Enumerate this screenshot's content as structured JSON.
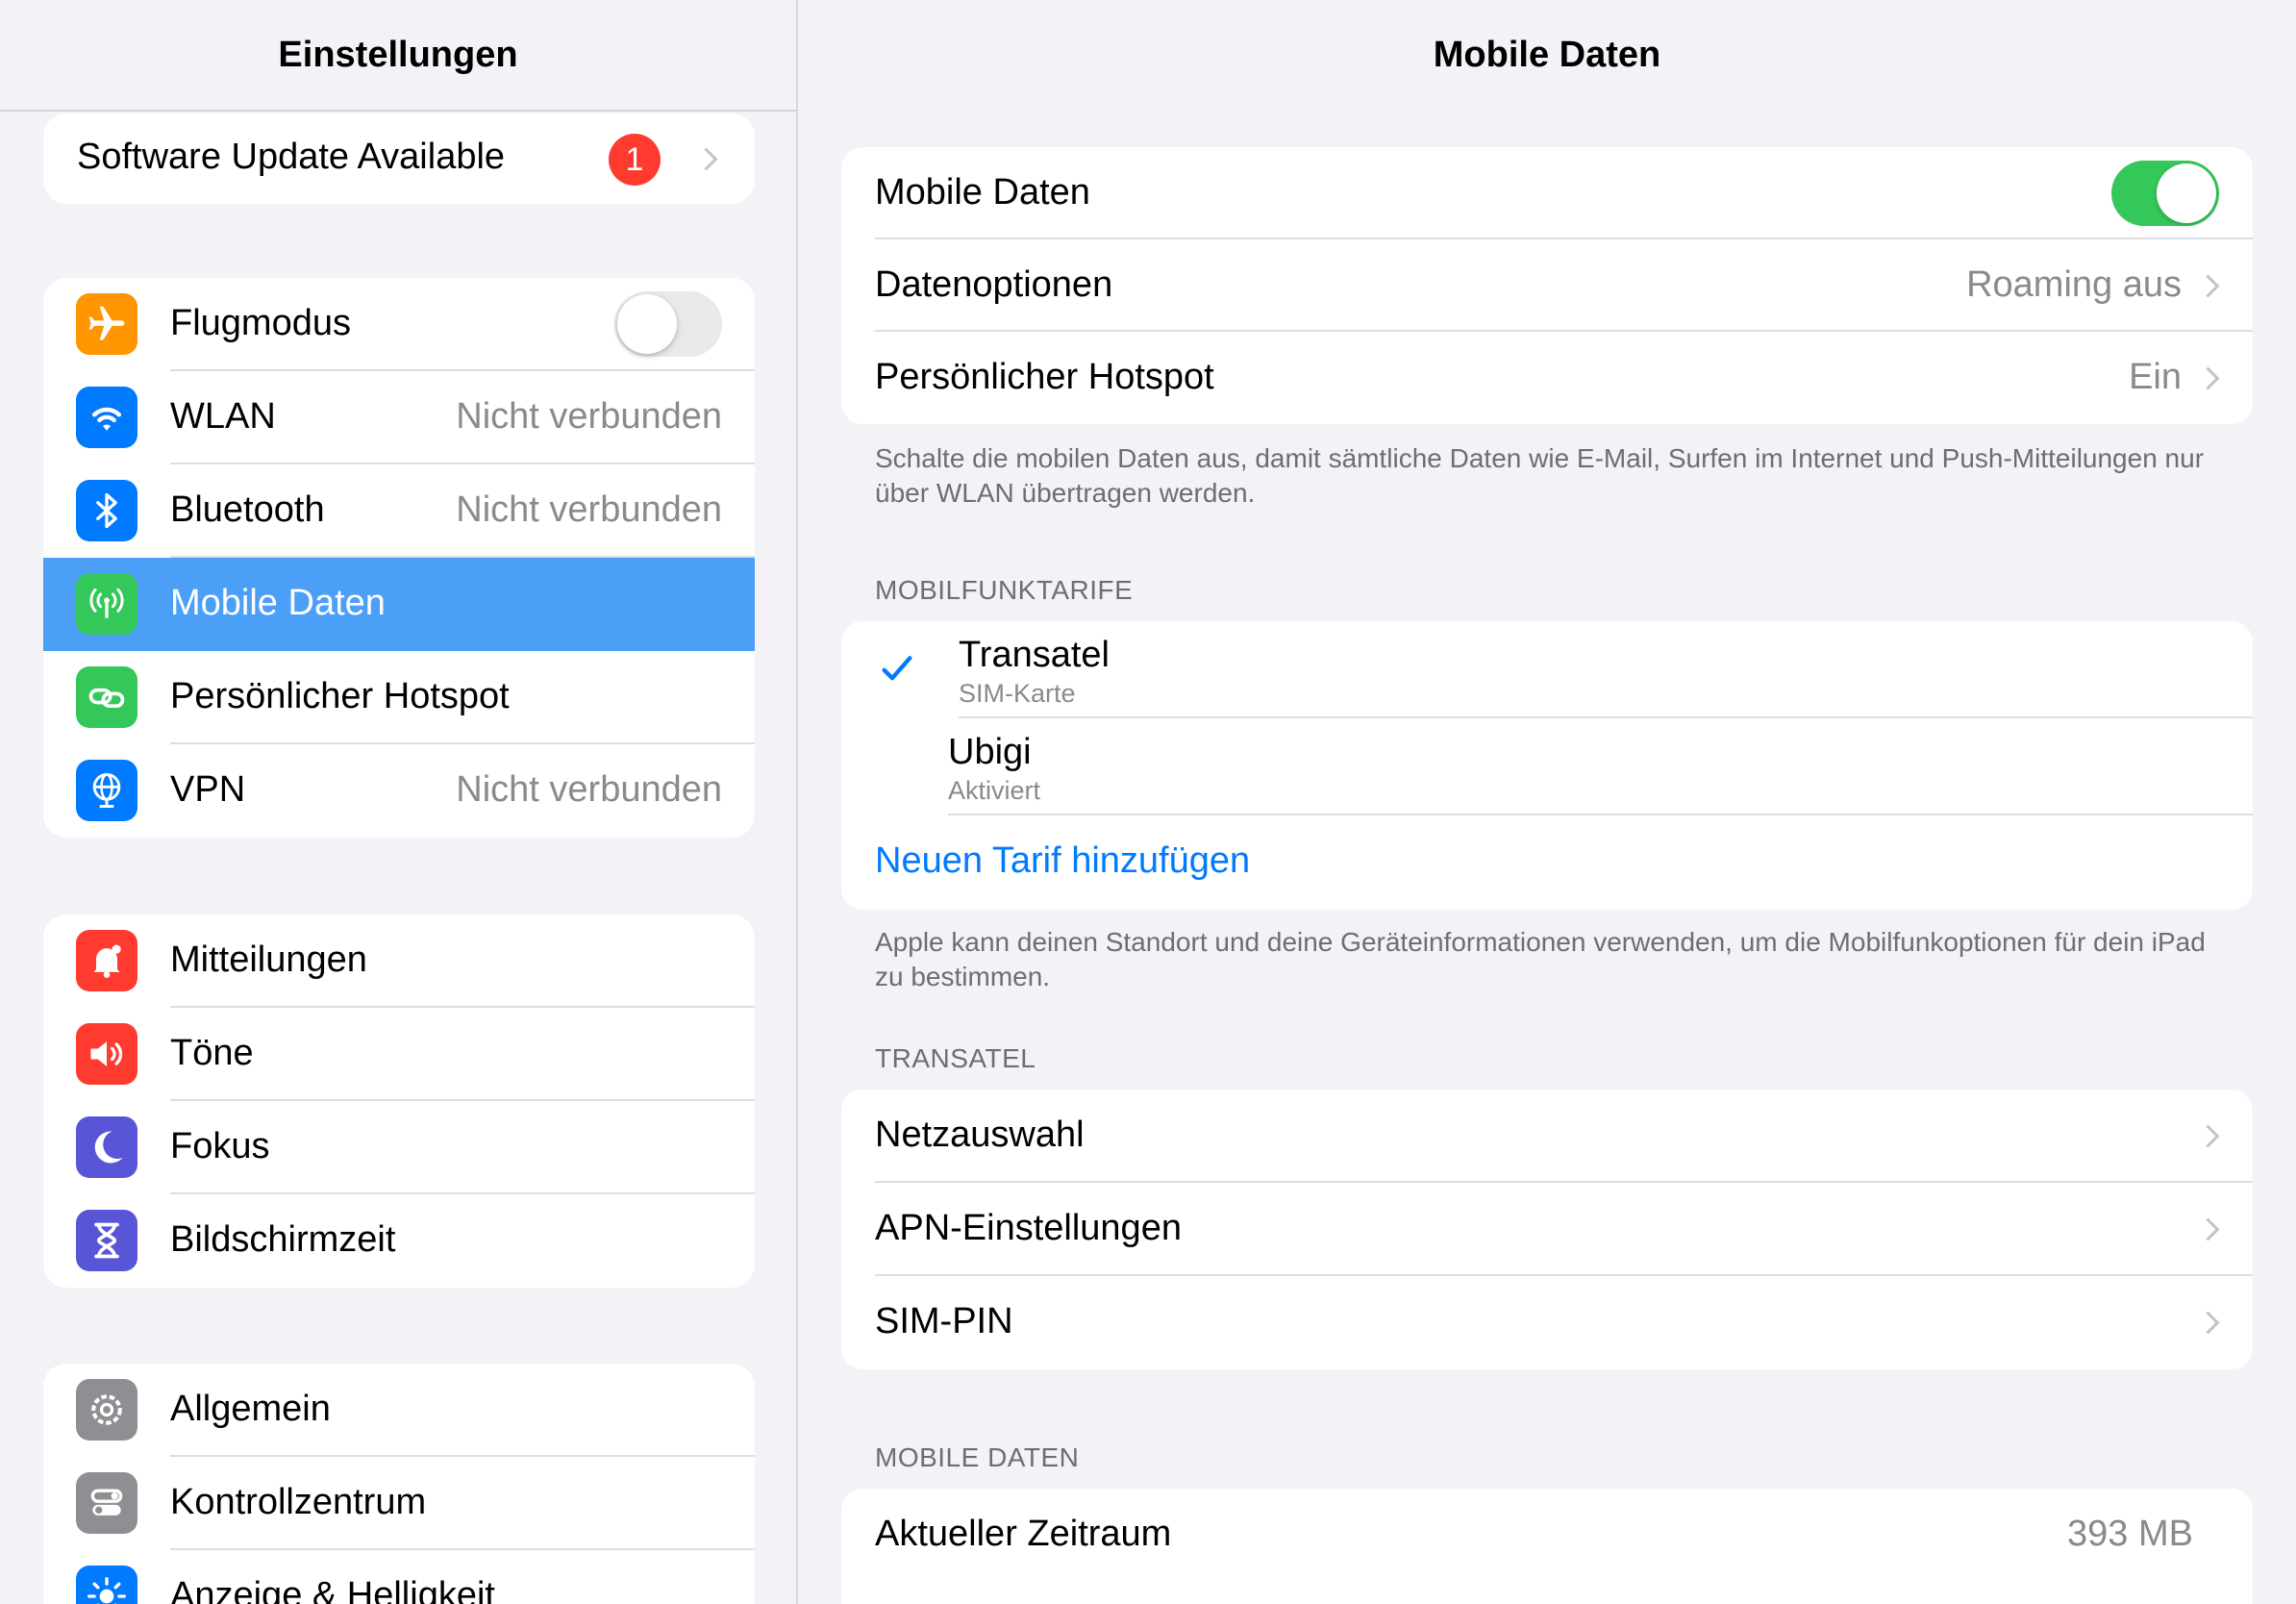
{
  "sidebar": {
    "title": "Einstellungen",
    "update": {
      "label": "Software Update Available",
      "badge": "1"
    },
    "group1": [
      {
        "label": "Flugmodus",
        "icon": "airplane-icon",
        "color": "#ff9500",
        "toggle": false
      },
      {
        "label": "WLAN",
        "value": "Nicht verbunden",
        "icon": "wifi-icon",
        "color": "#007aff"
      },
      {
        "label": "Bluetooth",
        "value": "Nicht verbunden",
        "icon": "bluetooth-icon",
        "color": "#007aff"
      },
      {
        "label": "Mobile Daten",
        "icon": "antenna-icon",
        "color": "#34c759",
        "selected": true
      },
      {
        "label": "Persönlicher Hotspot",
        "icon": "hotspot-icon",
        "color": "#34c759"
      },
      {
        "label": "VPN",
        "value": "Nicht verbunden",
        "icon": "globe-icon",
        "color": "#007aff"
      }
    ],
    "group2": [
      {
        "label": "Mitteilungen",
        "icon": "bell-icon",
        "color": "#ff3b30"
      },
      {
        "label": "Töne",
        "icon": "speaker-icon",
        "color": "#ff3b30"
      },
      {
        "label": "Fokus",
        "icon": "moon-icon",
        "color": "#5856d6"
      },
      {
        "label": "Bildschirmzeit",
        "icon": "hourglass-icon",
        "color": "#5856d6"
      }
    ],
    "group3": [
      {
        "label": "Allgemein",
        "icon": "gear-icon",
        "color": "#8e8e93"
      },
      {
        "label": "Kontrollzentrum",
        "icon": "switches-icon",
        "color": "#8e8e93"
      },
      {
        "label": "Anzeige & Helligkeit",
        "icon": "sun-icon",
        "color": "#007aff"
      }
    ]
  },
  "main": {
    "title": "Mobile Daten",
    "top": {
      "mobile_data": {
        "label": "Mobile Daten",
        "toggle": true
      },
      "data_options": {
        "label": "Datenoptionen",
        "value": "Roaming aus"
      },
      "hotspot": {
        "label": "Persönlicher Hotspot",
        "value": "Ein"
      }
    },
    "footnote1": "Schalte die mobilen Daten aus, damit sämtliche Daten wie E-Mail, Surfen im Internet und Push-Mitteilungen nur über WLAN übertragen werden.",
    "plans_header": "MOBILFUNKTARIFE",
    "plans": [
      {
        "name": "Transatel",
        "sub": "SIM-Karte",
        "checked": true
      },
      {
        "name": "Ubigi",
        "sub": "Aktiviert",
        "checked": false
      }
    ],
    "add_plan": "Neuen Tarif hinzufügen",
    "footnote2": "Apple kann deinen Standort und deine Geräteinformationen verwenden, um die Mobilfunkoptionen für dein iPad zu bestimmen.",
    "transatel_header": "TRANSATEL",
    "transatel_rows": [
      {
        "label": "Netzauswahl"
      },
      {
        "label": "APN-Einstellungen"
      },
      {
        "label": "SIM-PIN"
      }
    ],
    "usage_header": "MOBILE DATEN",
    "usage": {
      "label": "Aktueller Zeitraum",
      "value": "393 MB"
    }
  }
}
